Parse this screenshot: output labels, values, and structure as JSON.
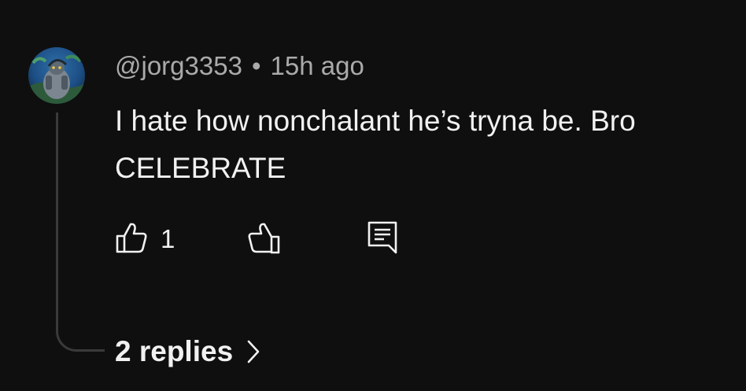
{
  "comment": {
    "author": "@jorg3353",
    "separator": "•",
    "timestamp": "15h ago",
    "text_line1": "I hate how nonchalant he’s tryna be. Bro",
    "text_line2": "CELEBRATE",
    "like_count": "1",
    "replies_label": "2 replies"
  },
  "icons": {
    "like": "thumbs-up-icon",
    "dislike": "thumbs-down-icon",
    "reply": "comment-reply-icon",
    "replies": "chevron-right-icon"
  },
  "colors": {
    "background": "#0f0f0f",
    "primary_text": "#f1f1f1",
    "secondary_text": "#aaaaaa",
    "thread_line": "#3a3a3a"
  }
}
